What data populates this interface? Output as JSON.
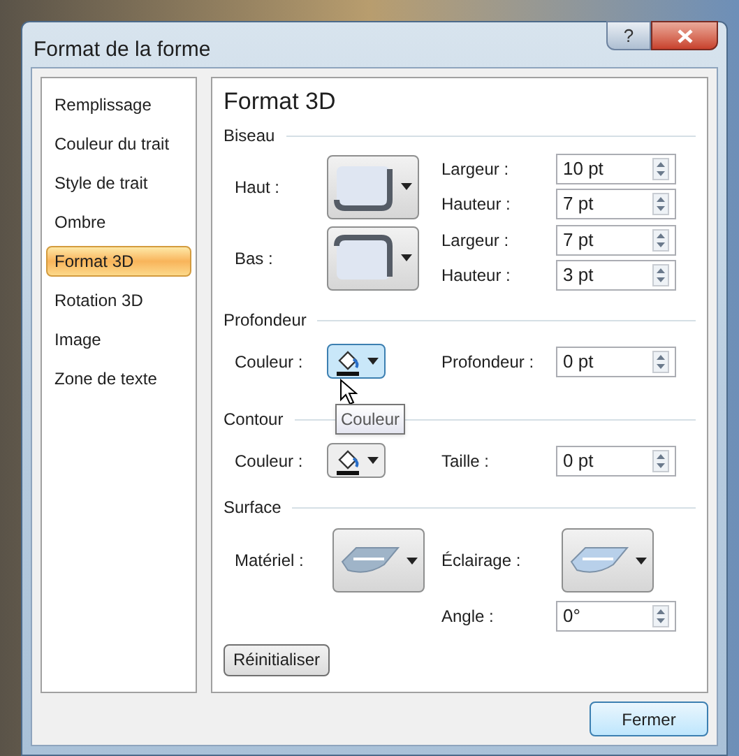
{
  "window": {
    "title": "Format de la forme"
  },
  "title_buttons": [
    {
      "kind": "help",
      "label": "?"
    },
    {
      "kind": "close"
    }
  ],
  "sidebar": {
    "items": [
      {
        "label": "Remplissage",
        "selected": false
      },
      {
        "label": "Couleur du trait",
        "selected": false
      },
      {
        "label": "Style de trait",
        "selected": false
      },
      {
        "label": "Ombre",
        "selected": false
      },
      {
        "label": "Format 3D",
        "selected": true
      },
      {
        "label": "Rotation 3D",
        "selected": false
      },
      {
        "label": "Image",
        "selected": false
      },
      {
        "label": "Zone de texte",
        "selected": false
      }
    ]
  },
  "panel": {
    "title": "Format 3D",
    "bevel": {
      "title": "Biseau",
      "rows": [
        {
          "label": "Haut :",
          "kind": "top",
          "fields": [
            {
              "label": "Largeur :",
              "value": "10 pt"
            },
            {
              "label": "Hauteur :",
              "value": "7 pt"
            }
          ]
        },
        {
          "label": "Bas :",
          "kind": "bottom",
          "fields": [
            {
              "label": "Largeur :",
              "value": "7 pt"
            },
            {
              "label": "Hauteur :",
              "value": "3 pt"
            }
          ]
        }
      ]
    },
    "depth": {
      "title": "Profondeur",
      "color_label": "Couleur :",
      "hovered": true,
      "tooltip": "Couleur",
      "field": {
        "label": "Profondeur :",
        "value": "0 pt"
      }
    },
    "contour": {
      "title": "Contour",
      "color_label": "Couleur :",
      "hovered": false,
      "field": {
        "label": "Taille :",
        "value": "0 pt"
      }
    },
    "surface": {
      "title": "Surface",
      "material_label": "Matériel :",
      "lighting_label": "Éclairage :",
      "angle": {
        "label": "Angle :",
        "value": "0°"
      }
    },
    "reset_button": "Réinitialiser"
  },
  "close_button": "Fermer"
}
